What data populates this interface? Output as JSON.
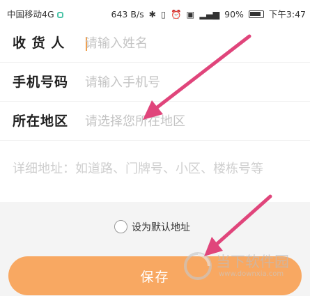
{
  "status_bar": {
    "carrier": "中国移动4G",
    "speed": "643 B/s",
    "battery": "90%",
    "time": "下午3:47"
  },
  "form": {
    "receiver": {
      "label": "收 货 人",
      "placeholder": "请输入姓名"
    },
    "phone": {
      "label": "手机号码",
      "placeholder": "请输入手机号"
    },
    "region": {
      "label": "所在地区",
      "placeholder": "请选择您所在地区"
    },
    "address": {
      "placeholder": "详细地址：如道路、门牌号、小区、楼栋号等"
    }
  },
  "default_address": {
    "label": "设为默认地址",
    "checked": false
  },
  "save_button": {
    "label": "保存",
    "color": "#f8a862"
  },
  "watermark": {
    "name": "当下软件园",
    "url": "www.downxia.com"
  },
  "colors": {
    "accent": "#f8a862",
    "arrow": "#e0457b"
  }
}
